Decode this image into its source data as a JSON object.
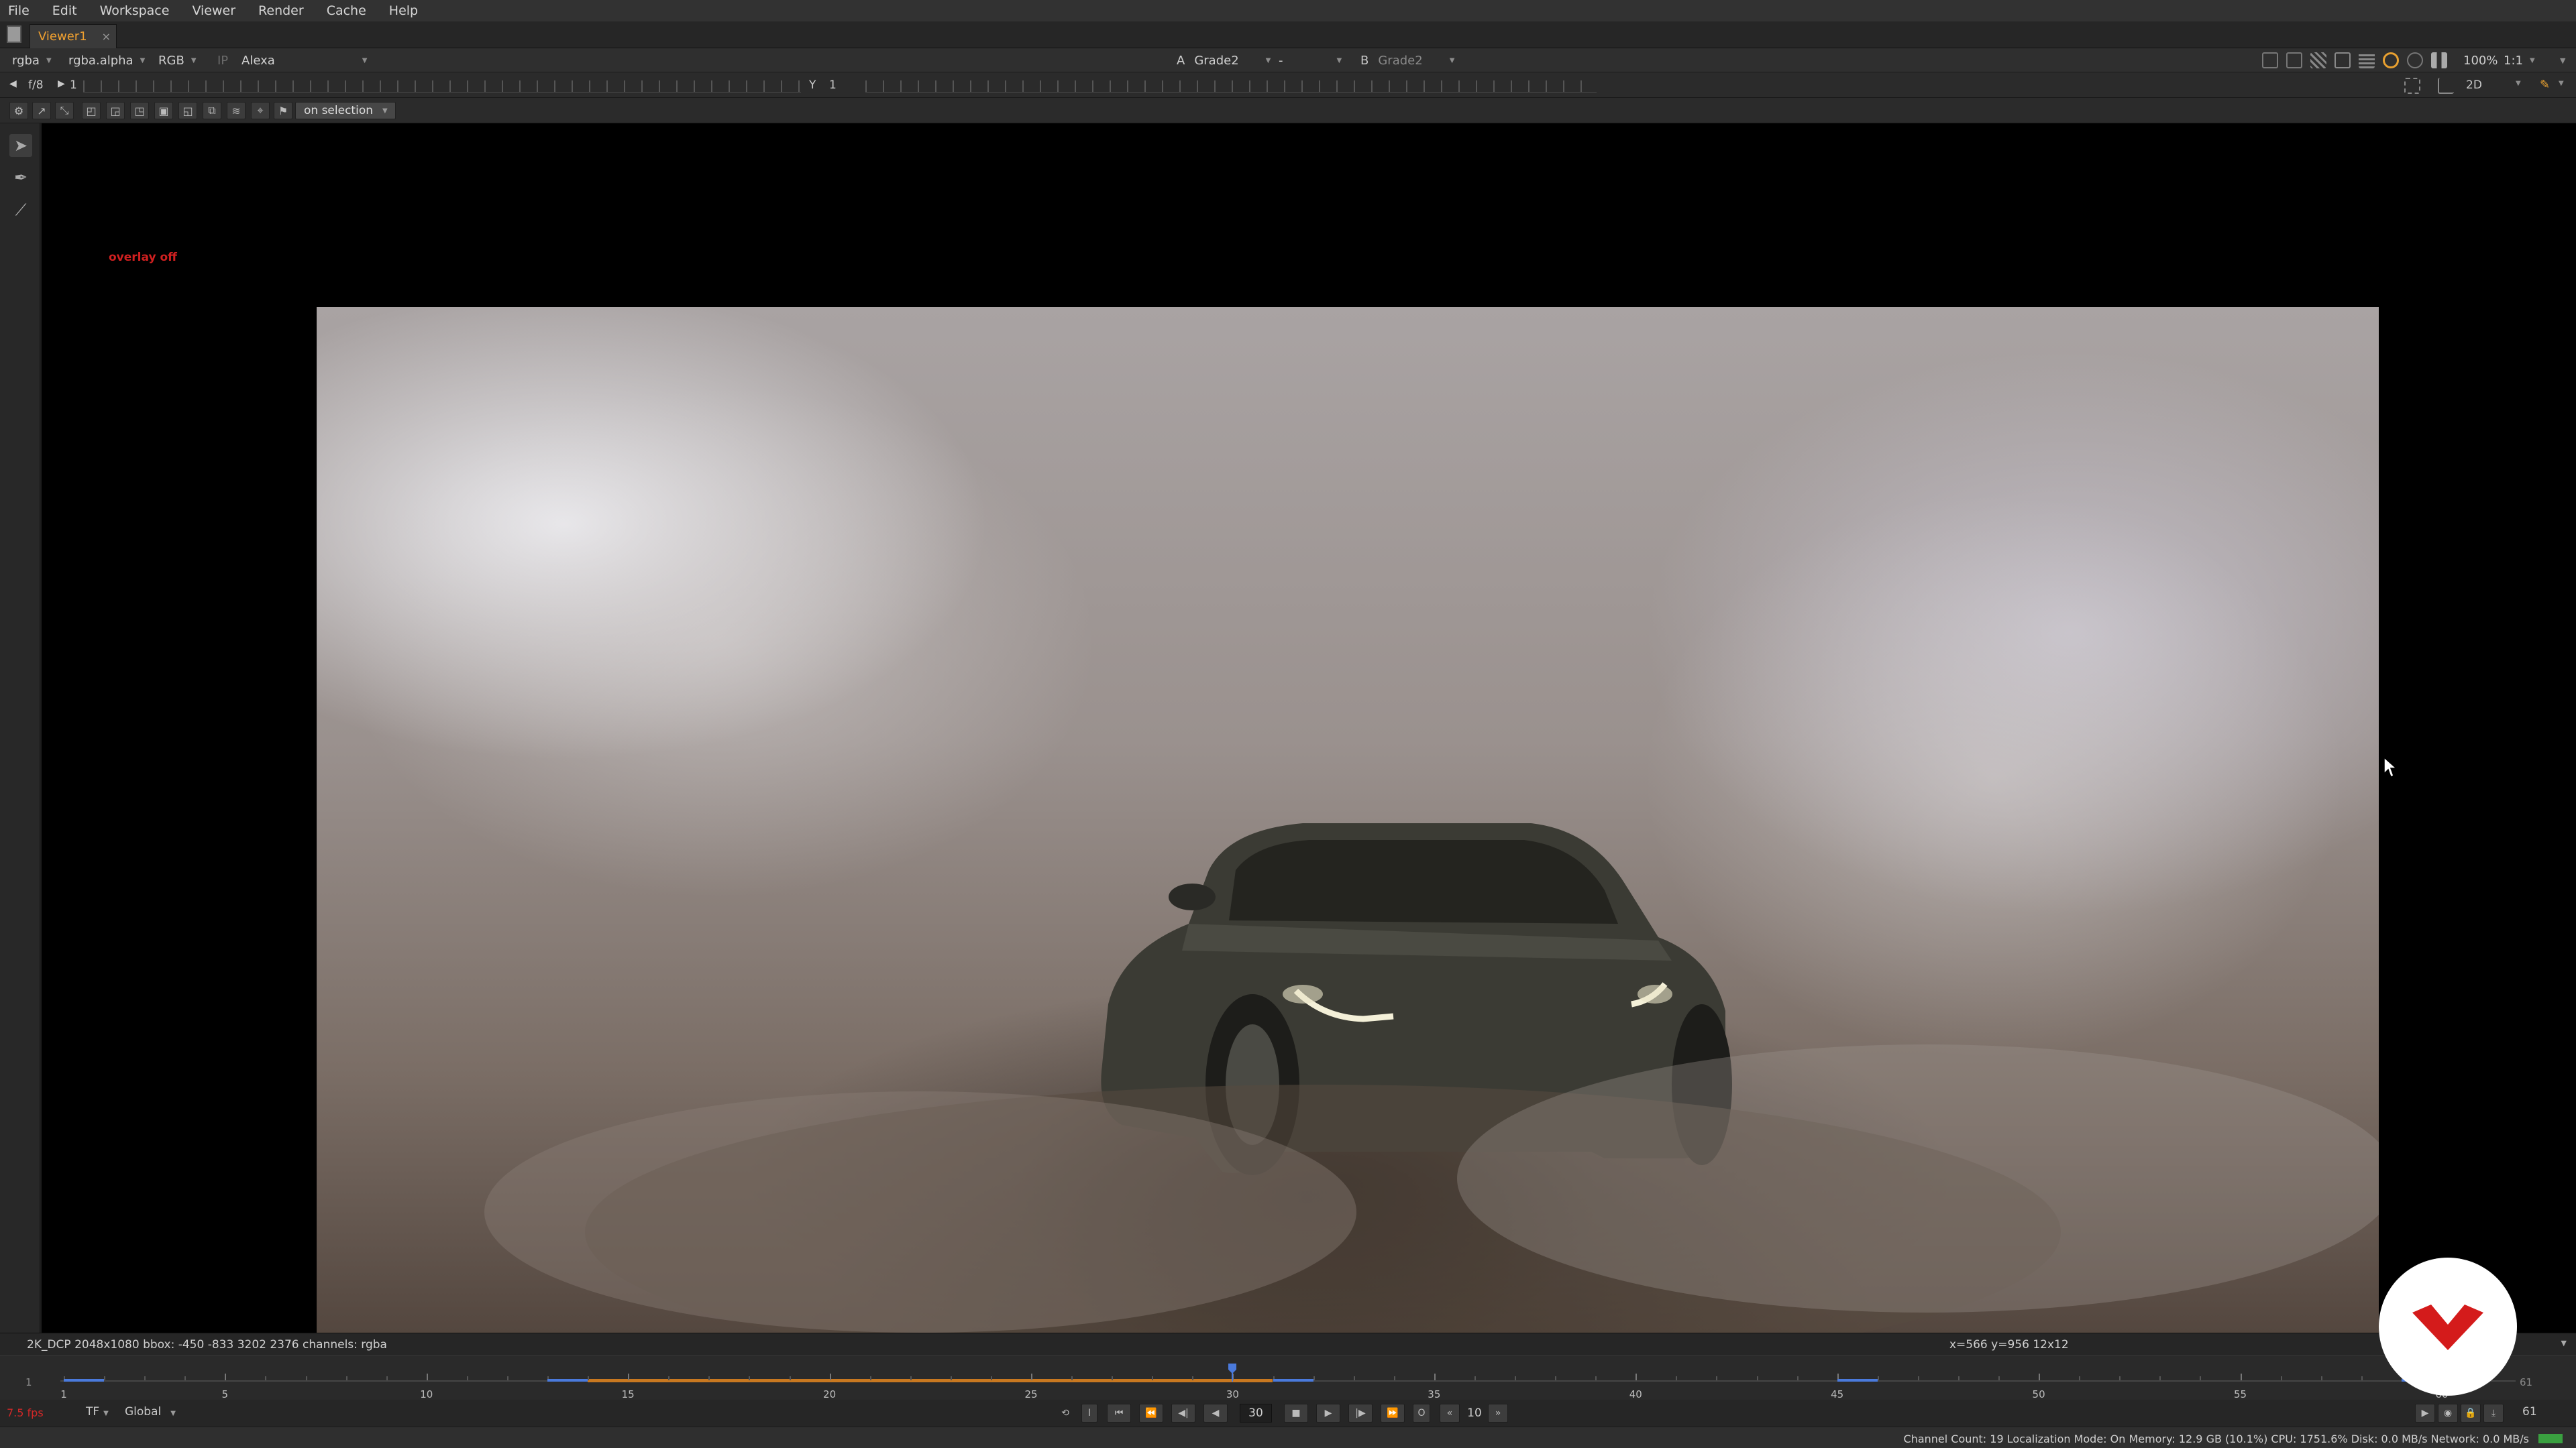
{
  "menubar": {
    "items": [
      "File",
      "Edit",
      "Workspace",
      "Viewer",
      "Render",
      "Cache",
      "Help"
    ]
  },
  "tabs": {
    "viewer_label": "Viewer1",
    "close": "×"
  },
  "channelbar": {
    "layer": "rgba",
    "alpha": "rgba.alpha",
    "display": "RGB",
    "ip": "IP",
    "lut": "Alexa",
    "input_a_letter": "A",
    "input_a": "Grade2",
    "compare_mode": "-",
    "input_b_letter": "B",
    "input_b": "Grade2",
    "zoom": "100%",
    "ratio": "1:1"
  },
  "framebar": {
    "fstop": "f/8",
    "frame": "1",
    "y_label": "Y",
    "y_value": "1",
    "view_mode": "2D"
  },
  "toolrow": {
    "selection_mode": "on selection"
  },
  "viewer": {
    "overlay_status": "overlay off"
  },
  "info": {
    "format": "2K_DCP 2048x1080  bbox: -450 -833 3202 2376 channels: rgba",
    "coords": "x=566 y=956 12x12"
  },
  "timeline": {
    "start": "1",
    "end": "61",
    "labels": [
      1,
      5,
      10,
      15,
      20,
      25,
      30,
      35,
      40,
      45,
      50,
      55,
      60
    ],
    "current_frame": 30,
    "range_start": 14,
    "range_end": 31
  },
  "transport": {
    "fps": "7.5 fps",
    "tf": "TF",
    "scope": "Global",
    "frame_value": "30",
    "increment": "10",
    "end_frame": "61"
  },
  "status": {
    "text": "Channel Count: 19  Localization Mode: On  Memory: 12.9 GB (10.1%)  CPU: 1751.6%  Disk: 0.0 MB/s  Network: 0.0 MB/s"
  },
  "colors": {
    "accent": "#f0a030",
    "range": "#c87820",
    "playhead": "#4a7adc",
    "logo_red": "#d41b1b"
  }
}
